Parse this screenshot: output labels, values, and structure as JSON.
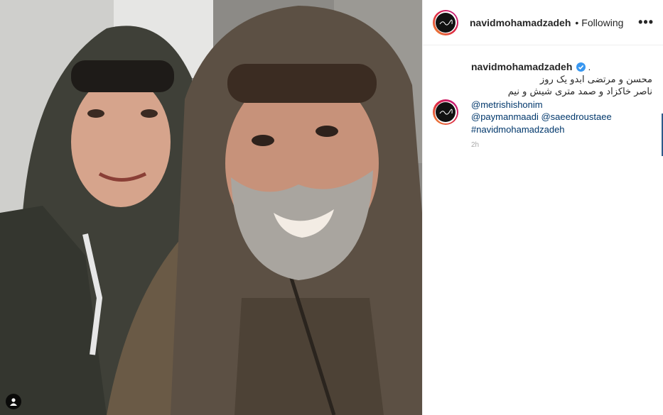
{
  "post": {
    "username": "navidmohamadzadeh",
    "separator": "•",
    "follow_status": "Following",
    "more_label": "•••"
  },
  "caption": {
    "username": "navidmohamadzadeh",
    "trailing": ".",
    "line1": "محسن و مرتضی ابدو یک روز",
    "line2": "ناصر خاکزاد و صمد متری شیش و نیم",
    "mention1": "@metrishishonim",
    "mention2": "@paymanmaadi",
    "mention3": "@saeedroustaee",
    "hashtag": "#navidmohamadzadeh",
    "time": "2h"
  },
  "colors": {
    "accent": "#3897f0",
    "link": "#00376b",
    "text": "#262626"
  },
  "icons": {
    "verified": "verified-badge-icon",
    "tags": "user-tag-icon",
    "more": "more-options-icon"
  }
}
